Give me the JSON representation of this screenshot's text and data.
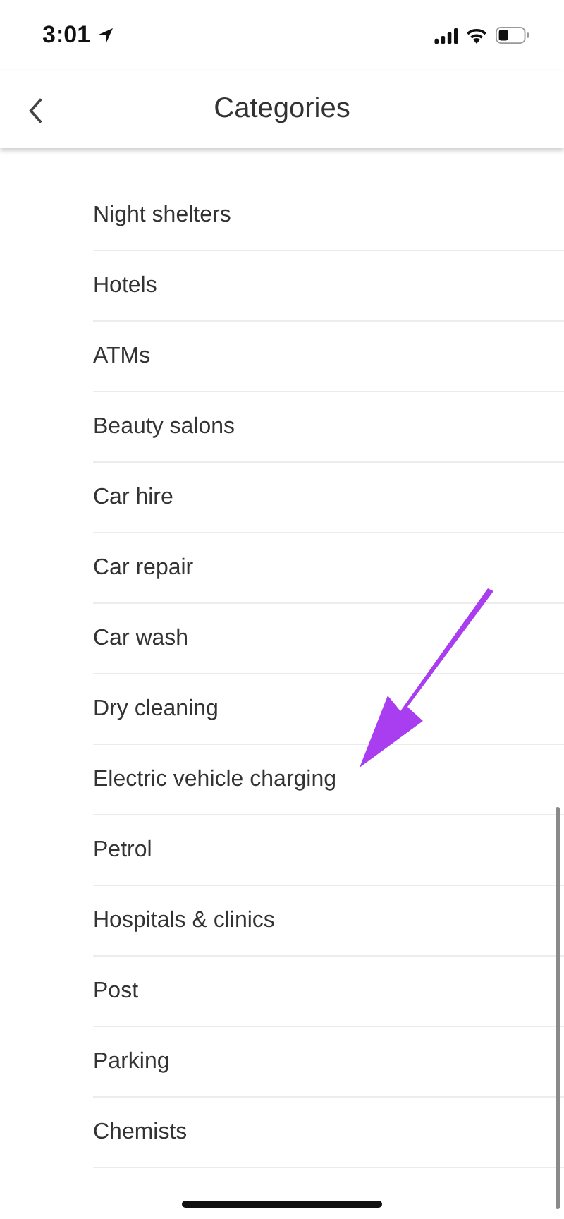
{
  "status_bar": {
    "time": "3:01"
  },
  "header": {
    "title": "Categories"
  },
  "categories": [
    {
      "label": "Night shelters"
    },
    {
      "label": "Hotels"
    },
    {
      "label": "ATMs"
    },
    {
      "label": "Beauty salons"
    },
    {
      "label": "Car hire"
    },
    {
      "label": "Car repair"
    },
    {
      "label": "Car wash"
    },
    {
      "label": "Dry cleaning"
    },
    {
      "label": "Electric vehicle charging"
    },
    {
      "label": "Petrol"
    },
    {
      "label": "Hospitals & clinics"
    },
    {
      "label": "Post"
    },
    {
      "label": "Parking"
    },
    {
      "label": "Chemists"
    }
  ]
}
